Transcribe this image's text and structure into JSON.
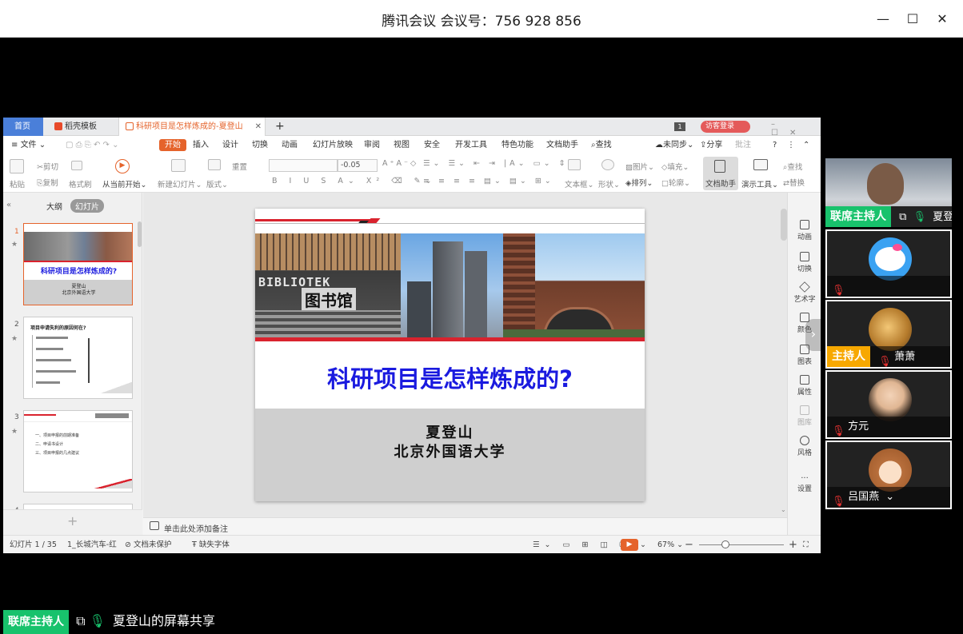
{
  "window": {
    "title": "腾讯会议 会议号：756 928 856",
    "minimize_icon": "—",
    "maximize_icon": "☐",
    "close_icon": "✕"
  },
  "wps": {
    "tabs": [
      {
        "label": "首页"
      },
      {
        "label": "稻壳模板"
      },
      {
        "label": "科研项目是怎样炼成的-夏登山"
      }
    ],
    "new_tab": "+",
    "page_count_badge": "1",
    "login_button": "访客登录",
    "menu": {
      "file": "文件",
      "start": "开始",
      "items": [
        "插入",
        "设计",
        "切换",
        "动画",
        "幻灯片放映",
        "审阅",
        "视图",
        "安全",
        "开发工具",
        "特色功能",
        "文档助手"
      ],
      "search": "查找",
      "sync": "未同步",
      "share": "分享",
      "comment": "批注",
      "help": "?"
    },
    "ribbon": {
      "paste": "粘贴",
      "cut": "剪切",
      "copy": "复制",
      "format_painter": "格式刷",
      "play_from_current": "从当前开始",
      "new_slide": "新建幻灯片",
      "layout": "版式",
      "reset": "重置",
      "font_size_delta": "-0.05",
      "textbox": "文本框",
      "shape": "形状",
      "arrange": "排列",
      "picture": "图片",
      "fill": "填充",
      "outline": "轮廓",
      "doc_assistant": "文档助手",
      "demo_tools": "演示工具",
      "find": "查找",
      "replace": "替换"
    },
    "left_panel": {
      "tab_outline": "大纲",
      "tab_slides": "幻灯片",
      "thumb1_title": "科研项目是怎样炼成的?",
      "thumb1_author": "夏登山",
      "thumb1_org": "北京外国语大学",
      "thumb2_title": "项目申请失利的原因何在?",
      "thumb3_items": [
        "一、项目申报的前期准备",
        "二、申请书设计",
        "三、项目申报的几点建议"
      ],
      "add": "+"
    },
    "slide": {
      "title": "科研项目是怎样炼成的?",
      "author": "夏登山",
      "org": "北京外国语大学",
      "library_sign": "图书馆",
      "library_text": "BIBLIOTEK"
    },
    "notes_placeholder": "单击此处添加备注",
    "right_panel": [
      "动画",
      "切换",
      "艺术字",
      "颜色",
      "图表",
      "属性",
      "图库",
      "风格",
      "设置"
    ],
    "status": {
      "slide_pos": "幻灯片 1 / 35",
      "theme": "1_长城汽车-红",
      "protect": "文档未保护",
      "missing_font": "缺失字体",
      "zoom": "67%"
    }
  },
  "participants": [
    {
      "name": "夏登山",
      "badge": "联席主持人"
    },
    {
      "name": "",
      "badge": ""
    },
    {
      "name": "萧萧",
      "badge": "主持人"
    },
    {
      "name": "方元",
      "badge": ""
    },
    {
      "name": "吕国燕",
      "badge": ""
    }
  ],
  "share_bar": {
    "badge": "联席主持人",
    "text": "夏登山的屏幕共享"
  },
  "colors": {
    "cohost_badge": "#18c26c",
    "host_badge": "#f7a800",
    "slide_title": "#1a1adf",
    "accent_red": "#d9232e",
    "wps_orange": "#e5632b"
  }
}
